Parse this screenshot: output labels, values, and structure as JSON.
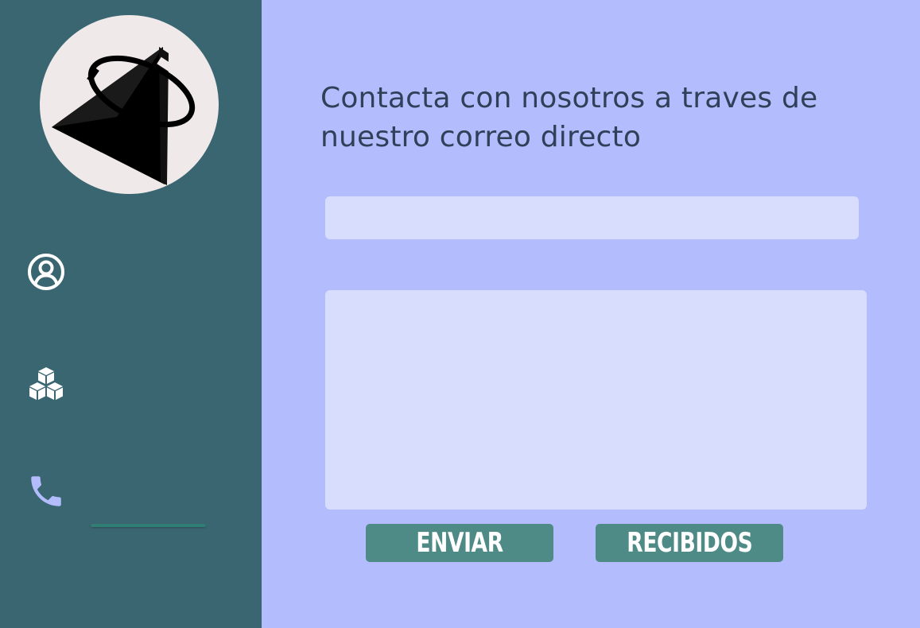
{
  "sidebar": {
    "logo": {
      "icon": "paper-plane-orbit-logo"
    },
    "nav": [
      {
        "icon": "user-circle-icon",
        "color": "#ffffff"
      },
      {
        "icon": "cubes-icon",
        "color": "#ffffff"
      },
      {
        "icon": "phone-icon",
        "color": "#b3bcfd",
        "active": true
      }
    ]
  },
  "main": {
    "heading": "Contacta con nosotros a traves de nuestro correo directo",
    "subject_field": {
      "value": "",
      "placeholder": ""
    },
    "message_field": {
      "value": "",
      "placeholder": ""
    },
    "buttons": {
      "send": "ENVIAR",
      "received": "RECIBIDOS"
    }
  },
  "colors": {
    "sidebar_bg": "#3a6672",
    "main_bg": "#b3bcfd",
    "field_bg": "#d8ddfd",
    "button_bg": "#4f8b86",
    "heading_text": "#2f4159",
    "active_indicator": "#2f7d73"
  }
}
